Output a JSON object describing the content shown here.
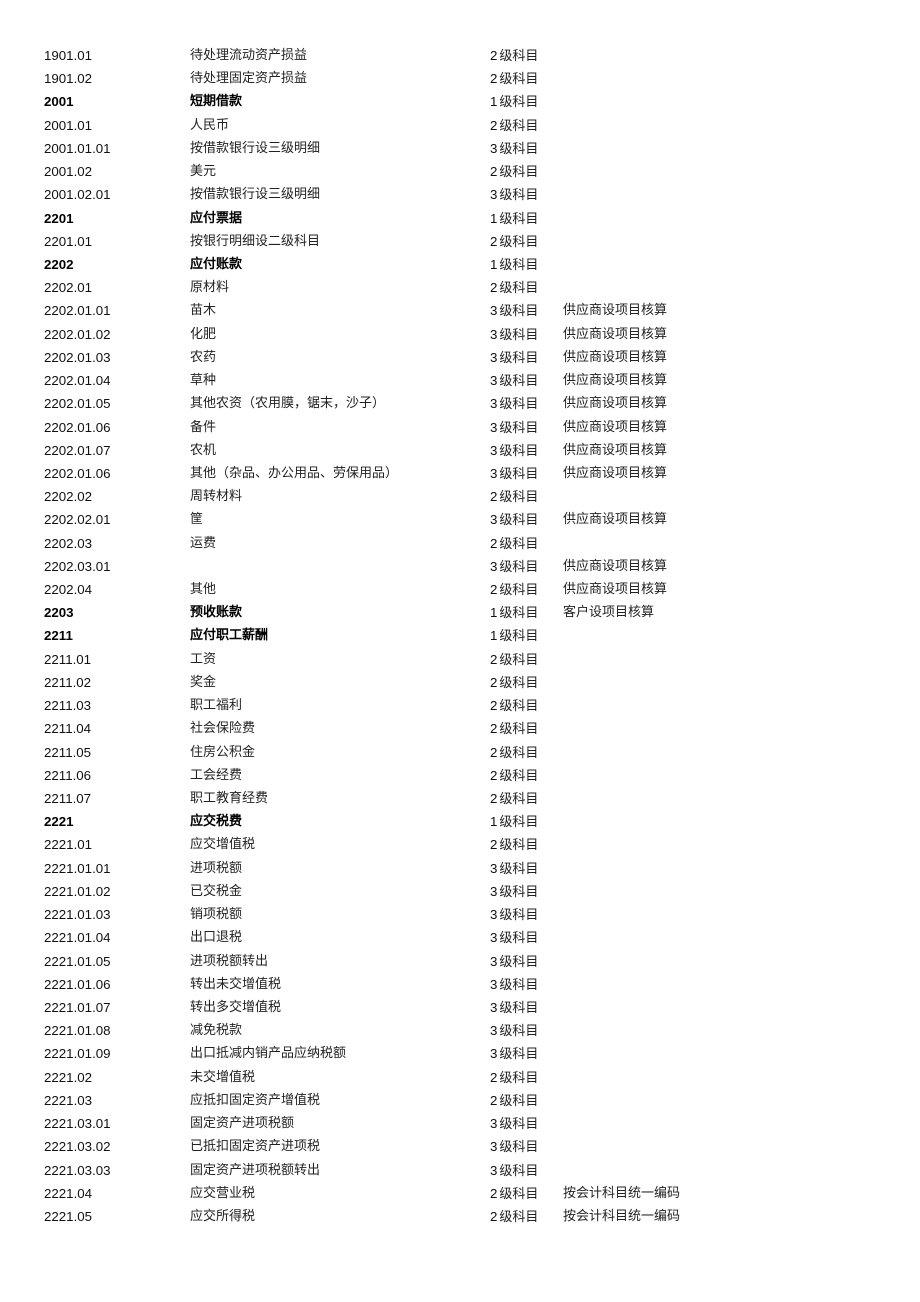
{
  "document": {
    "level_suffix": "级科目",
    "rows": [
      {
        "code": "1901.01",
        "name": "待处理流动资产损益",
        "level": "2",
        "note": "",
        "bold": false
      },
      {
        "code": "1901.02",
        "name": "待处理固定资产损益",
        "level": "2",
        "note": "",
        "bold": false
      },
      {
        "code": "2001",
        "name": "短期借款",
        "level": "1",
        "note": "",
        "bold": true
      },
      {
        "code": "2001.01",
        "name": "人民币",
        "level": "2",
        "note": "",
        "bold": false
      },
      {
        "code": "2001.01.01",
        "name": "按借款银行设三级明细",
        "level": "3",
        "note": "",
        "bold": false
      },
      {
        "code": "2001.02",
        "name": "美元",
        "level": "2",
        "note": "",
        "bold": false
      },
      {
        "code": "2001.02.01",
        "name": "按借款银行设三级明细",
        "level": "3",
        "note": "",
        "bold": false
      },
      {
        "code": "2201",
        "name": "应付票据",
        "level": "1",
        "note": "",
        "bold": true
      },
      {
        "code": "2201.01",
        "name": "按银行明细设二级科目",
        "level": "2",
        "note": "",
        "bold": false
      },
      {
        "code": "2202",
        "name": "应付账款",
        "level": "1",
        "note": "",
        "bold": true
      },
      {
        "code": "2202.01",
        "name": "原材料",
        "level": "2",
        "note": "",
        "bold": false
      },
      {
        "code": "2202.01.01",
        "name": "苗木",
        "level": "3",
        "note": "供应商设项目核算",
        "bold": false
      },
      {
        "code": "2202.01.02",
        "name": "化肥",
        "level": "3",
        "note": "供应商设项目核算",
        "bold": false
      },
      {
        "code": "2202.01.03",
        "name": "农药",
        "level": "3",
        "note": "供应商设项目核算",
        "bold": false
      },
      {
        "code": "2202.01.04",
        "name": "草种",
        "level": "3",
        "note": "供应商设项目核算",
        "bold": false
      },
      {
        "code": "2202.01.05",
        "name": "其他农资（农用膜，锯末，沙子）",
        "level": "3",
        "note": "供应商设项目核算",
        "bold": false
      },
      {
        "code": "2202.01.06",
        "name": "备件",
        "level": "3",
        "note": "供应商设项目核算",
        "bold": false
      },
      {
        "code": "2202.01.07",
        "name": "农机",
        "level": "3",
        "note": "供应商设项目核算",
        "bold": false
      },
      {
        "code": "2202.01.06",
        "name": "其他（杂品、办公用品、劳保用品）",
        "level": "3",
        "note": "供应商设项目核算",
        "bold": false
      },
      {
        "code": "2202.02",
        "name": "周转材料",
        "level": "2",
        "note": "",
        "bold": false
      },
      {
        "code": "2202.02.01",
        "name": "筐",
        "level": "3",
        "note": "供应商设项目核算",
        "bold": false
      },
      {
        "code": "2202.03",
        "name": "运费",
        "level": "2",
        "note": "",
        "bold": false
      },
      {
        "code": "2202.03.01",
        "name": "",
        "level": "3",
        "note": "供应商设项目核算",
        "bold": false
      },
      {
        "code": "2202.04",
        "name": "其他",
        "level": "2",
        "note": "供应商设项目核算",
        "bold": false
      },
      {
        "code": "2203",
        "name": "预收账款",
        "level": "1",
        "note": "客户设项目核算",
        "bold": true
      },
      {
        "code": "2211",
        "name": "应付职工薪酬",
        "level": "1",
        "note": "",
        "bold": true
      },
      {
        "code": "2211.01",
        "name": "工资",
        "level": "2",
        "note": "",
        "bold": false
      },
      {
        "code": "2211.02",
        "name": "奖金",
        "level": "2",
        "note": "",
        "bold": false
      },
      {
        "code": "2211.03",
        "name": "职工福利",
        "level": "2",
        "note": "",
        "bold": false
      },
      {
        "code": "2211.04",
        "name": "社会保险费",
        "level": "2",
        "note": "",
        "bold": false
      },
      {
        "code": "2211.05",
        "name": "住房公积金",
        "level": "2",
        "note": "",
        "bold": false
      },
      {
        "code": "2211.06",
        "name": "工会经费",
        "level": "2",
        "note": "",
        "bold": false
      },
      {
        "code": "2211.07",
        "name": "职工教育经费",
        "level": "2",
        "note": "",
        "bold": false
      },
      {
        "code": "2221",
        "name": "应交税费",
        "level": "1",
        "note": "",
        "bold": true
      },
      {
        "code": "2221.01",
        "name": "应交增值税",
        "level": "2",
        "note": "",
        "bold": false
      },
      {
        "code": "2221.01.01",
        "name": "进项税额",
        "level": "3",
        "note": "",
        "bold": false
      },
      {
        "code": "2221.01.02",
        "name": "已交税金",
        "level": "3",
        "note": "",
        "bold": false
      },
      {
        "code": "2221.01.03",
        "name": "销项税额",
        "level": "3",
        "note": "",
        "bold": false
      },
      {
        "code": "2221.01.04",
        "name": "出口退税",
        "level": "3",
        "note": "",
        "bold": false
      },
      {
        "code": "2221.01.05",
        "name": "进项税额转出",
        "level": "3",
        "note": "",
        "bold": false
      },
      {
        "code": "2221.01.06",
        "name": "转出未交增值税",
        "level": "3",
        "note": "",
        "bold": false
      },
      {
        "code": "2221.01.07",
        "name": "转出多交增值税",
        "level": "3",
        "note": "",
        "bold": false
      },
      {
        "code": "2221.01.08",
        "name": "减免税款",
        "level": "3",
        "note": "",
        "bold": false
      },
      {
        "code": "2221.01.09",
        "name": "出口抵减内销产品应纳税额",
        "level": "3",
        "note": "",
        "bold": false
      },
      {
        "code": "2221.02",
        "name": "未交增值税",
        "level": "2",
        "note": "",
        "bold": false
      },
      {
        "code": "2221.03",
        "name": "应抵扣固定资产增值税",
        "level": "2",
        "note": "",
        "bold": false
      },
      {
        "code": "2221.03.01",
        "name": "固定资产进项税额",
        "level": "3",
        "note": "",
        "bold": false
      },
      {
        "code": "2221.03.02",
        "name": "已抵扣固定资产进项税",
        "level": "3",
        "note": "",
        "bold": false
      },
      {
        "code": "2221.03.03",
        "name": "固定资产进项税额转出",
        "level": "3",
        "note": "",
        "bold": false
      },
      {
        "code": "2221.04",
        "name": "应交营业税",
        "level": "2",
        "note": "按会计科目统一编码",
        "bold": false
      },
      {
        "code": "2221.05",
        "name": "应交所得税",
        "level": "2",
        "note": "按会计科目统一编码",
        "bold": false
      }
    ]
  }
}
